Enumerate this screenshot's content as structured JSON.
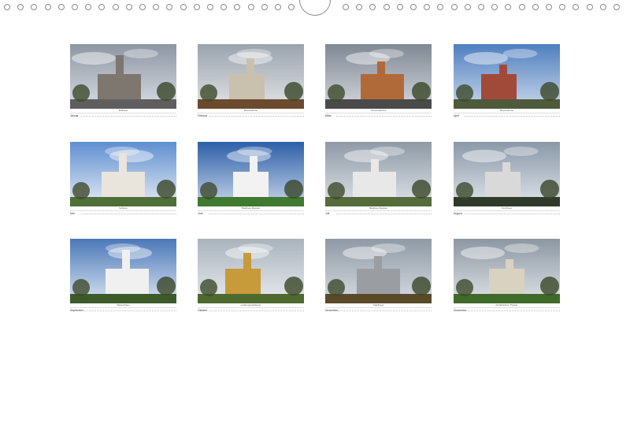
{
  "tiles": [
    {
      "month": "Januar",
      "caption": "Rathaus",
      "sky": "#8d96a3",
      "sky2": "#d8dde3",
      "ground": "#5e5e5e",
      "accent": "#7e776f"
    },
    {
      "month": "Februar",
      "caption": "Marienkirche",
      "sky": "#9aa3ad",
      "sky2": "#e2e4e6",
      "ground": "#6b4a2e",
      "accent": "#c9c0ae"
    },
    {
      "month": "März",
      "caption": "Johanniskirche",
      "sky": "#7f8894",
      "sky2": "#d4d7dc",
      "ground": "#4a4a4a",
      "accent": "#b06a3a"
    },
    {
      "month": "April",
      "caption": "Marienkirche",
      "sky": "#4f7fbf",
      "sky2": "#c9d7ea",
      "ground": "#4e5a3a",
      "accent": "#a24a3a"
    },
    {
      "month": "Mai",
      "caption": "Schloss",
      "sky": "#5f8fd0",
      "sky2": "#e5ecf5",
      "ground": "#4f6f38",
      "accent": "#e9e4dc"
    },
    {
      "month": "Juni",
      "caption": "Bauhaus Dessau",
      "sky": "#2d5fa8",
      "sky2": "#c8d6ea",
      "ground": "#3f7a2e",
      "accent": "#f2f2f2"
    },
    {
      "month": "Juli",
      "caption": "Bauhaus Dessau",
      "sky": "#8e9aa6",
      "sky2": "#dfe3e7",
      "ground": "#556b3a",
      "accent": "#e8e8e8"
    },
    {
      "month": "August",
      "caption": "Kornhaus",
      "sky": "#8a98a8",
      "sky2": "#dfe4ea",
      "ground": "#2f3a2a",
      "accent": "#d9d9d9"
    },
    {
      "month": "September",
      "caption": "Meisterhaus",
      "sky": "#4a78b8",
      "sky2": "#dbe6f2",
      "ground": "#3d5a2a",
      "accent": "#f0f0f0"
    },
    {
      "month": "Oktober",
      "caption": "Laubenganghäuser",
      "sky": "#a9b3bd",
      "sky2": "#e8ebee",
      "ground": "#4e6a2e",
      "accent": "#c79a3a"
    },
    {
      "month": "November",
      "caption": "Stahlhaus",
      "sky": "#8f9aa5",
      "sky2": "#d7dce2",
      "ground": "#5a4a2a",
      "accent": "#9a9ea3"
    },
    {
      "month": "Dezember",
      "caption": "Anhaltisches Theater",
      "sky": "#8c97a2",
      "sky2": "#dfe3e7",
      "ground": "#3f6a2a",
      "accent": "#d9d2c0"
    }
  ]
}
